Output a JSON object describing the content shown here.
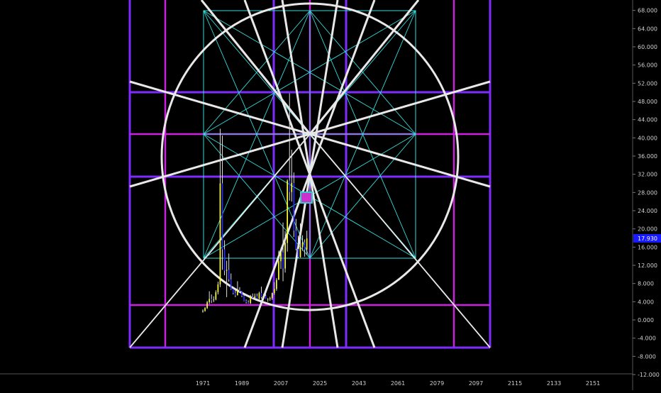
{
  "chart_data": {
    "type": "candlestick",
    "xlabel": "",
    "ylabel": "",
    "x_ticks": [
      "1971",
      "1989",
      "2007",
      "2025",
      "2043",
      "2061",
      "2079",
      "2097",
      "2115",
      "2133",
      "2151"
    ],
    "y_ticks": [
      "68.000",
      "64.000",
      "60.000",
      "56.000",
      "52.000",
      "48.000",
      "44.000",
      "40.000",
      "36.000",
      "32.000",
      "28.000",
      "24.000",
      "20.000",
      "16.000",
      "12.000",
      "8.000",
      "4.000",
      "0.000",
      "-4.000",
      "-8.000",
      "-12.000"
    ],
    "ylim": [
      -12,
      70
    ],
    "xlim": [
      1958,
      2160
    ],
    "last_price": "17.930",
    "grid": false,
    "colors": {
      "background": "#000000",
      "candle_up": "#ffff33",
      "candle_down": "#2d2dff",
      "wick": "#dddddd",
      "circle": "#e8e8e8",
      "spokes": "#e8e8e8",
      "gann_lines": "#33dddd",
      "frame_purple": "#7f2bff",
      "frame_magenta": "#cc22dd",
      "price_tag": "#1a1aff",
      "marker_fill": "#cc33cc",
      "marker_border": "#33cccc"
    },
    "series": [
      {
        "values": [
          [
            1971,
            1.9,
            2.3,
            1.6,
            2.0
          ],
          [
            1972,
            2.0,
            2.8,
            1.8,
            2.6
          ],
          [
            1973,
            2.6,
            4.2,
            2.4,
            3.9
          ],
          [
            1974,
            3.9,
            6.3,
            3.5,
            4.6
          ],
          [
            1975,
            4.6,
            5.6,
            3.7,
            4.3
          ],
          [
            1976,
            4.3,
            5.2,
            3.9,
            4.5
          ],
          [
            1977,
            4.5,
            6.5,
            4.3,
            6.1
          ],
          [
            1978,
            6.1,
            8.4,
            5.6,
            7.8
          ],
          [
            1979,
            7.8,
            42.0,
            7.2,
            30.0
          ],
          [
            1980,
            30.0,
            40.5,
            11.0,
            15.5
          ],
          [
            1981,
            15.5,
            17.5,
            9.8,
            10.8
          ],
          [
            1982,
            10.8,
            13.0,
            5.0,
            11.0
          ],
          [
            1983,
            11.0,
            14.6,
            8.4,
            8.9
          ],
          [
            1984,
            8.9,
            10.2,
            6.6,
            6.8
          ],
          [
            1985,
            6.8,
            7.0,
            5.6,
            5.9
          ],
          [
            1986,
            5.9,
            6.6,
            5.0,
            5.4
          ],
          [
            1987,
            5.4,
            8.5,
            5.4,
            6.6
          ],
          [
            1988,
            6.6,
            7.2,
            6.0,
            6.2
          ],
          [
            1989,
            6.2,
            6.3,
            5.0,
            5.3
          ],
          [
            1990,
            5.3,
            5.6,
            4.1,
            4.2
          ],
          [
            1991,
            4.2,
            4.5,
            3.6,
            3.9
          ],
          [
            1992,
            3.9,
            4.3,
            3.6,
            3.7
          ],
          [
            1993,
            3.7,
            5.5,
            3.5,
            5.1
          ],
          [
            1994,
            5.1,
            5.8,
            4.7,
            4.8
          ],
          [
            1995,
            4.8,
            5.8,
            4.6,
            5.2
          ],
          [
            1996,
            5.2,
            5.8,
            4.6,
            4.7
          ],
          [
            1997,
            4.7,
            6.2,
            4.3,
            5.9
          ],
          [
            1998,
            5.9,
            7.3,
            4.7,
            5.0
          ],
          [
            1999,
            5.0,
            5.7,
            4.8,
            5.3
          ],
          [
            2000,
            5.3,
            5.6,
            4.6,
            4.6
          ],
          [
            2001,
            4.6,
            4.8,
            4.0,
            4.6
          ],
          [
            2002,
            4.6,
            5.1,
            4.2,
            4.8
          ],
          [
            2003,
            4.8,
            6.0,
            4.4,
            5.9
          ],
          [
            2004,
            5.9,
            8.3,
            5.5,
            6.8
          ],
          [
            2005,
            6.8,
            9.2,
            6.4,
            8.8
          ],
          [
            2006,
            8.8,
            15.2,
            8.8,
            12.9
          ],
          [
            2007,
            12.9,
            15.8,
            11.2,
            14.8
          ],
          [
            2008,
            14.8,
            21.4,
            8.5,
            11.3
          ],
          [
            2009,
            11.3,
            19.5,
            10.4,
            16.9
          ],
          [
            2010,
            16.9,
            30.9,
            15.0,
            30.6
          ],
          [
            2011,
            30.6,
            49.8,
            26.2,
            28.1
          ],
          [
            2012,
            28.1,
            37.4,
            26.0,
            30.1
          ],
          [
            2013,
            30.1,
            32.4,
            18.2,
            19.6
          ],
          [
            2014,
            19.6,
            22.2,
            15.3,
            15.6
          ],
          [
            2015,
            15.6,
            18.5,
            13.6,
            13.8
          ],
          [
            2016,
            13.8,
            21.2,
            13.7,
            16.0
          ],
          [
            2017,
            16.0,
            18.6,
            15.2,
            17.0
          ],
          [
            2018,
            17.0,
            17.7,
            13.9,
            15.5
          ],
          [
            2019,
            15.5,
            19.6,
            14.3,
            17.9
          ]
        ]
      }
    ]
  }
}
